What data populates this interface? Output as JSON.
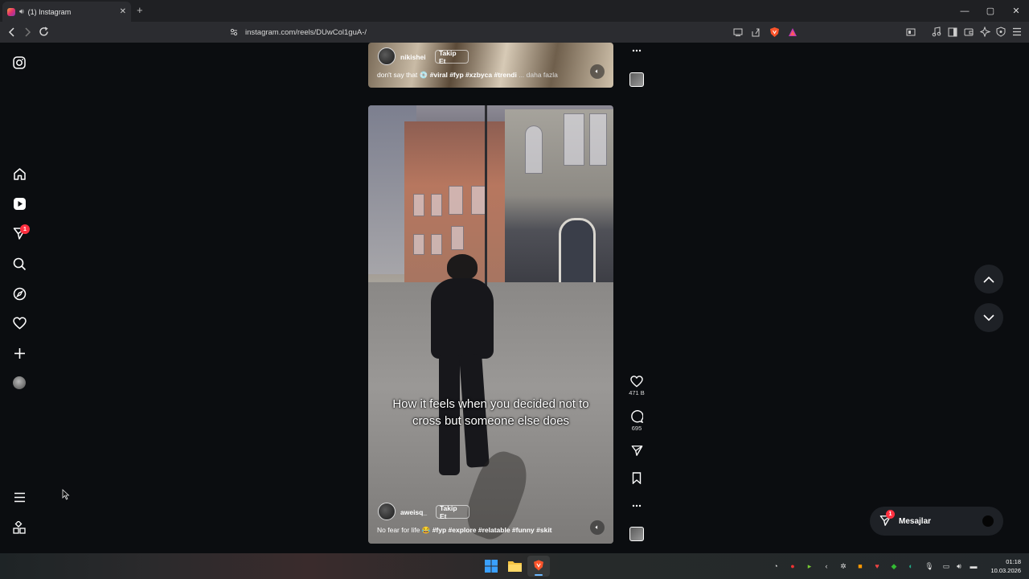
{
  "browser": {
    "tab_title": "(1) Instagram",
    "new_tab": "+",
    "url": "instagram.com/reels/DUwCol1guA-/",
    "window_controls": {
      "minimize": "—",
      "maximize": "▢",
      "close": "✕"
    }
  },
  "sidebar": {
    "logo_icon": "instagram-icon",
    "items": [
      {
        "name": "home",
        "icon": "home-icon"
      },
      {
        "name": "reels",
        "icon": "reels-icon"
      },
      {
        "name": "messages",
        "icon": "send-icon",
        "badge": "1"
      },
      {
        "name": "search",
        "icon": "search-icon"
      },
      {
        "name": "explore",
        "icon": "compass-icon"
      },
      {
        "name": "notifications",
        "icon": "heart-icon"
      },
      {
        "name": "create",
        "icon": "plus-icon"
      },
      {
        "name": "profile",
        "icon": "avatar"
      }
    ],
    "menu_icon": "menu-icon",
    "more_icon": "apps-icon"
  },
  "reel_top": {
    "username": "nikishei",
    "follow": "Takip Et",
    "caption_text": "don't say that 💿",
    "caption_tags": "#viral #fyp #xzbyca #trendi",
    "more": "... daha fazla"
  },
  "reel_main": {
    "subtitle": "How it feels when you decided not to cross but someone else does",
    "username": "aweisq_",
    "follow": "Takip Et",
    "caption_text": "No fear for life 😂",
    "caption_tags": "#fyp #explore #relatable #funny #skit"
  },
  "actions": {
    "likes": "471 B",
    "comments": "695"
  },
  "messages": {
    "label": "Mesajlar",
    "badge": "1"
  },
  "taskbar": {
    "time": "01:18",
    "date": "10.03.2026"
  },
  "colors": {
    "background": "#0b0d10",
    "badge": "#ff3040",
    "chrome": "#2b2c30"
  }
}
